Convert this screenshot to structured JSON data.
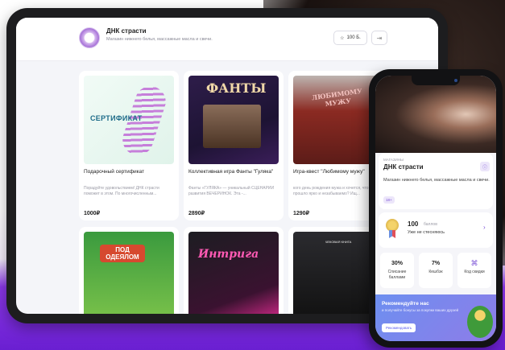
{
  "tablet": {
    "header": {
      "title": "ДНК страсти",
      "subtitle": "Магазин нижнего белья, массажные масла и свечи.",
      "points": "100 Б.",
      "points_icon": "star-icon",
      "logout_icon": "logout-icon"
    },
    "products": [
      {
        "name": "Подарочный сертификат",
        "desc": "Порадуйте удовольствием! ДНК страсти поможет в этом. По многочисленным...",
        "price": "1000₽",
        "image_text": "СЕРТИФИКАТ"
      },
      {
        "name": "Коллективная игра Фанты \"Гуляка\"",
        "desc": "Фанты «ГУЛЯКА» — уникальный СЦЕНАРИЙ развития ВЕЧЕРИНОК. Эта -...",
        "price": "2890₽",
        "image_text": "ФАНТЫ"
      },
      {
        "name": "Игра-квест \"Любимому мужу\"",
        "desc": "кого день рождения мужа и хочется, что бы прошло ярко и незабываемо? Ищ...",
        "price": "1290₽",
        "image_text": "ЛЮБИМОМУ МУЖУ"
      },
      {
        "name": "",
        "desc": "",
        "price": "",
        "image_text": "ПОД ОДЕЯЛОМ"
      },
      {
        "name": "",
        "desc": "",
        "price": "",
        "image_text": "Интрига"
      },
      {
        "name": "",
        "desc": "",
        "price": "",
        "image_text": "ЧЕКОВАЯ КНИГА"
      }
    ]
  },
  "phone": {
    "section_label": "МАГАЗИНЫ",
    "shop_title": "ДНК страсти",
    "shop_desc": "Магазин нижнего белья, массажные масла и свечи.",
    "age": "18+",
    "info_icon": "info-icon",
    "bonus": {
      "value": "100",
      "unit": "баллов",
      "status": "Уже не стесняюсь"
    },
    "tiles": [
      {
        "big": "30%",
        "small": "Списание баллами"
      },
      {
        "big": "7%",
        "small": "Кешбэк"
      },
      {
        "big": "",
        "small": "Код скидки",
        "icon": "qr-code-icon"
      }
    ],
    "referral": {
      "title": "Рекомендуйте нас",
      "subtitle": "и получайте бонусы за покупки ваших друзей",
      "button": "Рекомендовать"
    }
  }
}
